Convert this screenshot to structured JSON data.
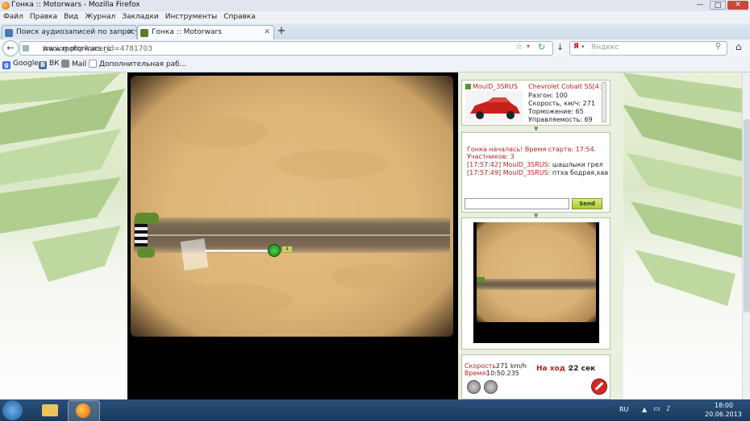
{
  "window": {
    "title": "Гонка :: Motorwars - Mozilla Firefox"
  },
  "menu": [
    "Файл",
    "Правка",
    "Вид",
    "Журнал",
    "Закладки",
    "Инструменты",
    "Справка"
  ],
  "tabs": [
    {
      "label": "Поиск аудиозаписей по запросу кф..."
    },
    {
      "label": "Гонка :: Motorwars"
    }
  ],
  "nav": {
    "url_host": "www.motorwars.ru",
    "url_path": "/racing.php?race_id=4781703",
    "search_placeholder": "Яндекс"
  },
  "bookmarks": [
    "Google",
    "ВК",
    "Mail",
    "Дополнительная раб..."
  ],
  "car": {
    "driver": "MoulD_3SRUS",
    "model": "Chevrolet Cobalt SS[4:",
    "stats": [
      "Разгон: 100",
      "Скорость, км/ч: 271",
      "Торможение: 65",
      "Управляемость: 69"
    ]
  },
  "chat": {
    "messages": [
      {
        "text": "Гонка началась! Время старта: 17:54.",
        "color": "#b3261e"
      },
      {
        "text": "Участников: 3",
        "color": "#b3261e"
      },
      {
        "time": "[17:57:42]",
        "user": "MoulD_3SRUS:",
        "msg": "шашлыки грел"
      },
      {
        "time": "[17:57:49]",
        "user": "MoulD_3SRUS:",
        "msg": "птха бодрая,хаа"
      }
    ],
    "send_label": "Send"
  },
  "game": {
    "finish_marker": "4"
  },
  "status": {
    "speed_label": "Скорость:",
    "speed_value": "271 km/h",
    "time_label": "Время:",
    "time_value": "10:50.235",
    "turn_label": "На ход :",
    "turn_value": "22 сек"
  },
  "tray": {
    "lang": "RU",
    "time": "18:00",
    "date": "20.06.2013"
  },
  "colors": {
    "accent_red": "#b3261e",
    "panel_green": "#e8f0e0",
    "taskbar": "#1b3a5e"
  }
}
